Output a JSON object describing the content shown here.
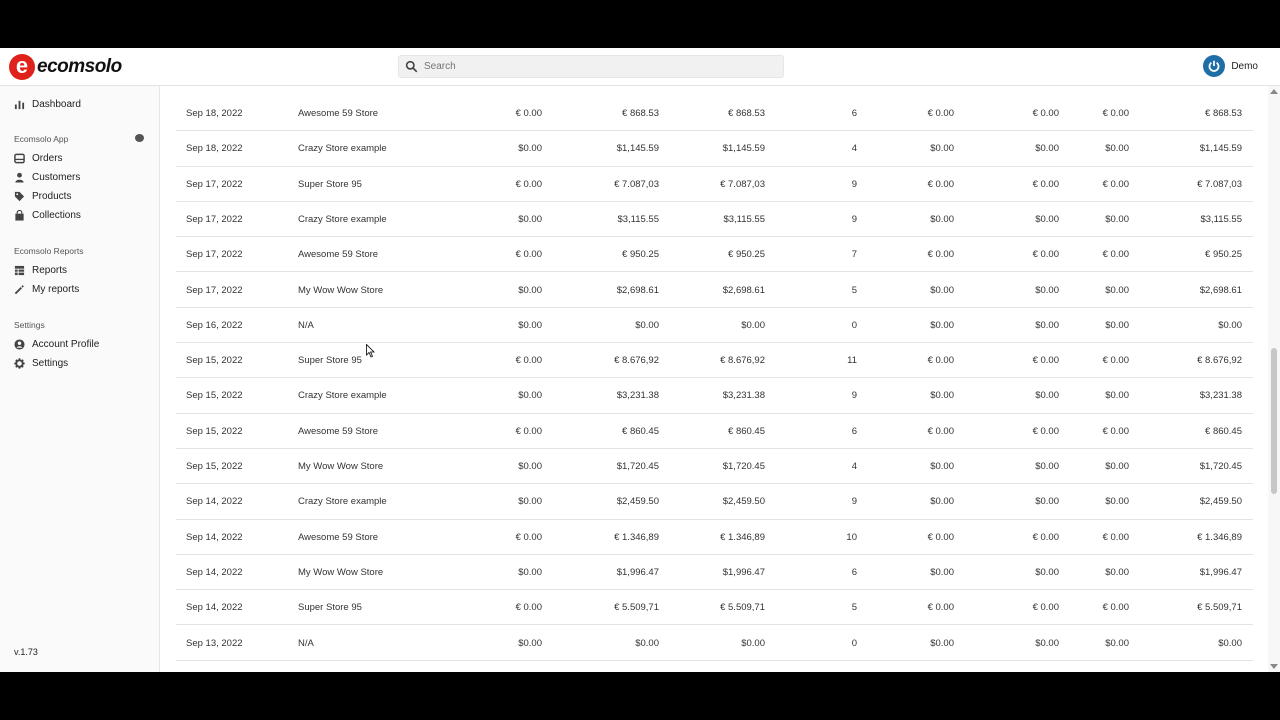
{
  "brand": {
    "name": "ecomsolo",
    "mark": "e",
    "color": "#e0201b"
  },
  "search": {
    "placeholder": "Search"
  },
  "user": {
    "name": "Demo"
  },
  "sidebar": {
    "dashboard": "Dashboard",
    "app_section": "Ecomsolo App",
    "orders": "Orders",
    "customers": "Customers",
    "products": "Products",
    "collections": "Collections",
    "reports_section": "Ecomsolo Reports",
    "reports": "Reports",
    "my_reports": "My reports",
    "settings_section": "Settings",
    "account_profile": "Account Profile",
    "settings": "Settings",
    "version": "v.1.73"
  },
  "table": {
    "rows": [
      [
        "Sep 18, 2022",
        "Awesome 59 Store",
        "€ 0.00",
        "€ 868.53",
        "€ 868.53",
        "6",
        "€ 0.00",
        "€ 0.00",
        "€ 0.00",
        "€ 868.53"
      ],
      [
        "Sep 18, 2022",
        "Crazy Store example",
        "$0.00",
        "$1,145.59",
        "$1,145.59",
        "4",
        "$0.00",
        "$0.00",
        "$0.00",
        "$1,145.59"
      ],
      [
        "Sep 17, 2022",
        "Super Store 95",
        "€ 0.00",
        "€ 7.087,03",
        "€ 7.087,03",
        "9",
        "€ 0.00",
        "€ 0.00",
        "€ 0.00",
        "€ 7.087,03"
      ],
      [
        "Sep 17, 2022",
        "Crazy Store example",
        "$0.00",
        "$3,115.55",
        "$3,115.55",
        "9",
        "$0.00",
        "$0.00",
        "$0.00",
        "$3,115.55"
      ],
      [
        "Sep 17, 2022",
        "Awesome 59 Store",
        "€ 0.00",
        "€ 950.25",
        "€ 950.25",
        "7",
        "€ 0.00",
        "€ 0.00",
        "€ 0.00",
        "€ 950.25"
      ],
      [
        "Sep 17, 2022",
        "My Wow Wow Store",
        "$0.00",
        "$2,698.61",
        "$2,698.61",
        "5",
        "$0.00",
        "$0.00",
        "$0.00",
        "$2,698.61"
      ],
      [
        "Sep 16, 2022",
        "N/A",
        "$0.00",
        "$0.00",
        "$0.00",
        "0",
        "$0.00",
        "$0.00",
        "$0.00",
        "$0.00"
      ],
      [
        "Sep 15, 2022",
        "Super Store 95",
        "€ 0.00",
        "€ 8.676,92",
        "€ 8.676,92",
        "11",
        "€ 0.00",
        "€ 0.00",
        "€ 0.00",
        "€ 8.676,92"
      ],
      [
        "Sep 15, 2022",
        "Crazy Store example",
        "$0.00",
        "$3,231.38",
        "$3,231.38",
        "9",
        "$0.00",
        "$0.00",
        "$0.00",
        "$3,231.38"
      ],
      [
        "Sep 15, 2022",
        "Awesome 59 Store",
        "€ 0.00",
        "€ 860.45",
        "€ 860.45",
        "6",
        "€ 0.00",
        "€ 0.00",
        "€ 0.00",
        "€ 860.45"
      ],
      [
        "Sep 15, 2022",
        "My Wow Wow Store",
        "$0.00",
        "$1,720.45",
        "$1,720.45",
        "4",
        "$0.00",
        "$0.00",
        "$0.00",
        "$1,720.45"
      ],
      [
        "Sep 14, 2022",
        "Crazy Store example",
        "$0.00",
        "$2,459.50",
        "$2,459.50",
        "9",
        "$0.00",
        "$0.00",
        "$0.00",
        "$2,459.50"
      ],
      [
        "Sep 14, 2022",
        "Awesome 59 Store",
        "€ 0.00",
        "€ 1.346,89",
        "€ 1.346,89",
        "10",
        "€ 0.00",
        "€ 0.00",
        "€ 0.00",
        "€ 1.346,89"
      ],
      [
        "Sep 14, 2022",
        "My Wow Wow Store",
        "$0.00",
        "$1,996.47",
        "$1,996.47",
        "6",
        "$0.00",
        "$0.00",
        "$0.00",
        "$1,996.47"
      ],
      [
        "Sep 14, 2022",
        "Super Store 95",
        "€ 0.00",
        "€ 5.509,71",
        "€ 5.509,71",
        "5",
        "€ 0.00",
        "€ 0.00",
        "€ 0.00",
        "€ 5.509,71"
      ],
      [
        "Sep 13, 2022",
        "N/A",
        "$0.00",
        "$0.00",
        "$0.00",
        "0",
        "$0.00",
        "$0.00",
        "$0.00",
        "$0.00"
      ]
    ]
  }
}
